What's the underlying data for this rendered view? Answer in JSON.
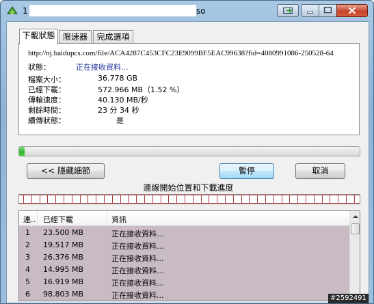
{
  "window": {
    "title_prefix": "1",
    "title_suffix": "so",
    "colors": {
      "title_gradient": "#9dbfde",
      "close": "#c8452d",
      "progress": "#2fb52c",
      "list_bg": "#c9bbc3"
    }
  },
  "tabs": [
    {
      "label": "下載狀態",
      "active": true
    },
    {
      "label": "限速器",
      "active": false
    },
    {
      "label": "完成選項",
      "active": false
    }
  ],
  "details": {
    "url": "http://nj.baidupcs.com/file/ACA4287C453CFC23E9099BF5EAC99638?fid=4080991086-250528-64",
    "status_label": "狀態：",
    "status_value": "正在接收資料...",
    "file_size_label": "檔案大小：",
    "file_size_value": "36.778 GB",
    "downloaded_label": "已經下載：",
    "downloaded_value": "572.966 MB（1.52 %）",
    "speed_label": "傳輸速度：",
    "speed_value": "40.130 MB/秒",
    "remaining_label": "剩餘時間：",
    "remaining_value": "23 分 34 秒",
    "resume_label": "續傳狀態：",
    "resume_value": "是"
  },
  "progress": {
    "percent": 1.52
  },
  "buttons": {
    "hide_details": "<< 隱藏細節",
    "pause": "暫停",
    "cancel": "取消"
  },
  "connections": {
    "title": "連線開始位置和下載進度",
    "columns": [
      "連..",
      "已經下載",
      "資訊"
    ],
    "rows": [
      {
        "id": "1",
        "downloaded": "23.500  MB",
        "info": "正在接收資料..."
      },
      {
        "id": "2",
        "downloaded": "19.517  MB",
        "info": "正在接收資料..."
      },
      {
        "id": "3",
        "downloaded": "26.376  MB",
        "info": "正在接收資料..."
      },
      {
        "id": "4",
        "downloaded": "14.995  MB",
        "info": "正在接收資料..."
      },
      {
        "id": "5",
        "downloaded": "16.919  MB",
        "info": "正在接收資料..."
      },
      {
        "id": "6",
        "downloaded": "98.803  MB",
        "info": "正在接收資料..."
      }
    ]
  },
  "watermark": "#2592491"
}
